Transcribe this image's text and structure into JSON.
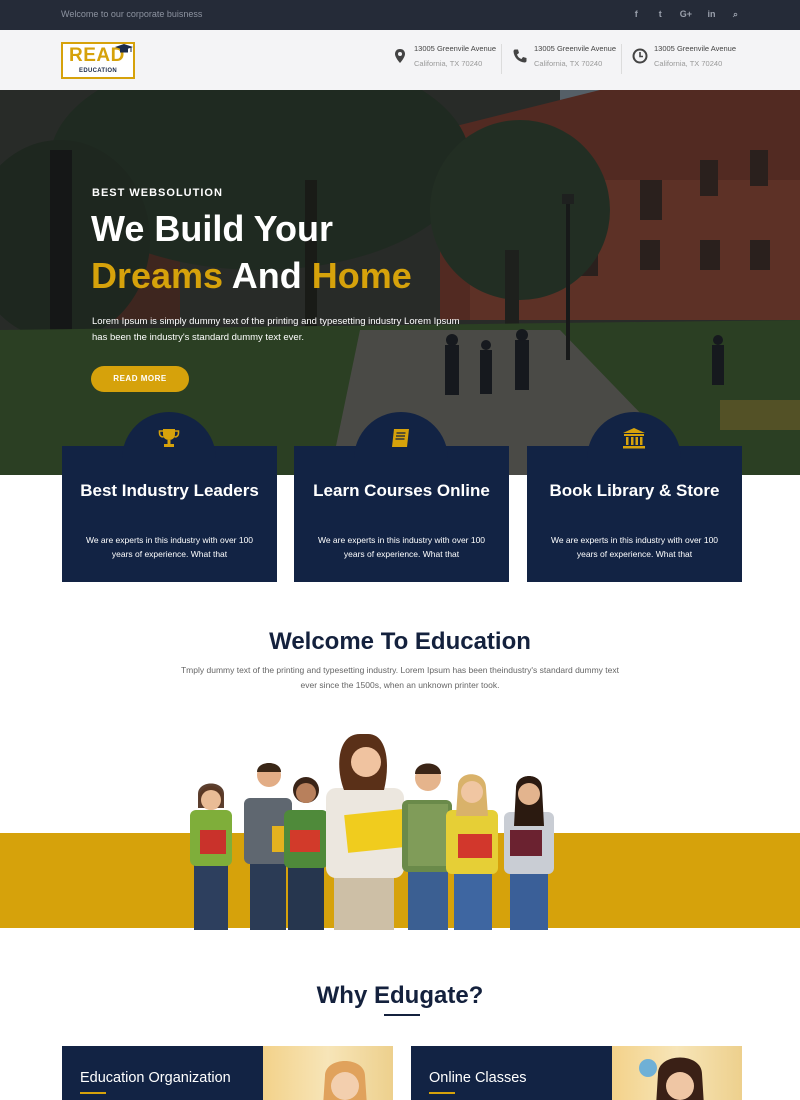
{
  "topbar": {
    "welcome": "Welcome to our corporate buisness",
    "social": [
      {
        "icon": "facebook-icon",
        "glyph": "f"
      },
      {
        "icon": "twitter-icon",
        "glyph": "t"
      },
      {
        "icon": "google-plus-icon",
        "glyph": "G+"
      },
      {
        "icon": "linkedin-icon",
        "glyph": "in"
      },
      {
        "icon": "search-icon",
        "glyph": "⌕"
      }
    ]
  },
  "header": {
    "logo": {
      "word": "READ",
      "sub": "EDUCATION"
    },
    "contacts": [
      {
        "icon": "map-pin-icon",
        "line1": "13005 Greenvile Avenue",
        "line2": "California, TX 70240"
      },
      {
        "icon": "phone-icon",
        "line1": "13005 Greenvile Avenue",
        "line2": "California, TX 70240"
      },
      {
        "icon": "clock-icon",
        "line1": "13005 Greenvile Avenue",
        "line2": "California, TX 70240"
      }
    ]
  },
  "hero": {
    "kicker": "BEST WEBSOLUTION",
    "line1": "We Build Your",
    "line2_a": "Dreams",
    "line2_b": " And ",
    "line2_c": "Home",
    "description": "Lorem Ipsum is simply dummy text of the printing and typesetting industry Lorem Ipsum has been the industry's standard dummy text ever.",
    "button": "READ MORE"
  },
  "features": [
    {
      "icon": "trophy-icon",
      "title": "Best Industry Leaders",
      "text": "We are experts in this industry with over 100 years of experience. What that"
    },
    {
      "icon": "book-icon",
      "title": "Learn Courses Online",
      "text": "We are experts in this industry with over 100 years of experience. What that"
    },
    {
      "icon": "library-icon",
      "title": "Book Library & Store",
      "text": "We are experts in this industry with over 100 years of experience. What that"
    }
  ],
  "welcome": {
    "title": "Welcome To Education",
    "text": "Tmply dummy text of the printing and typesetting industry. Lorem Ipsum has been theindustry's standard dummy text ever since the 1500s, when an unknown printer took."
  },
  "why": {
    "title": "Why Edugate?",
    "cards": [
      {
        "title": "Education Organization"
      },
      {
        "title": "Online Classes"
      }
    ]
  },
  "colors": {
    "accent": "#d6a20b",
    "navy": "#122344",
    "topbar": "#252b38"
  }
}
